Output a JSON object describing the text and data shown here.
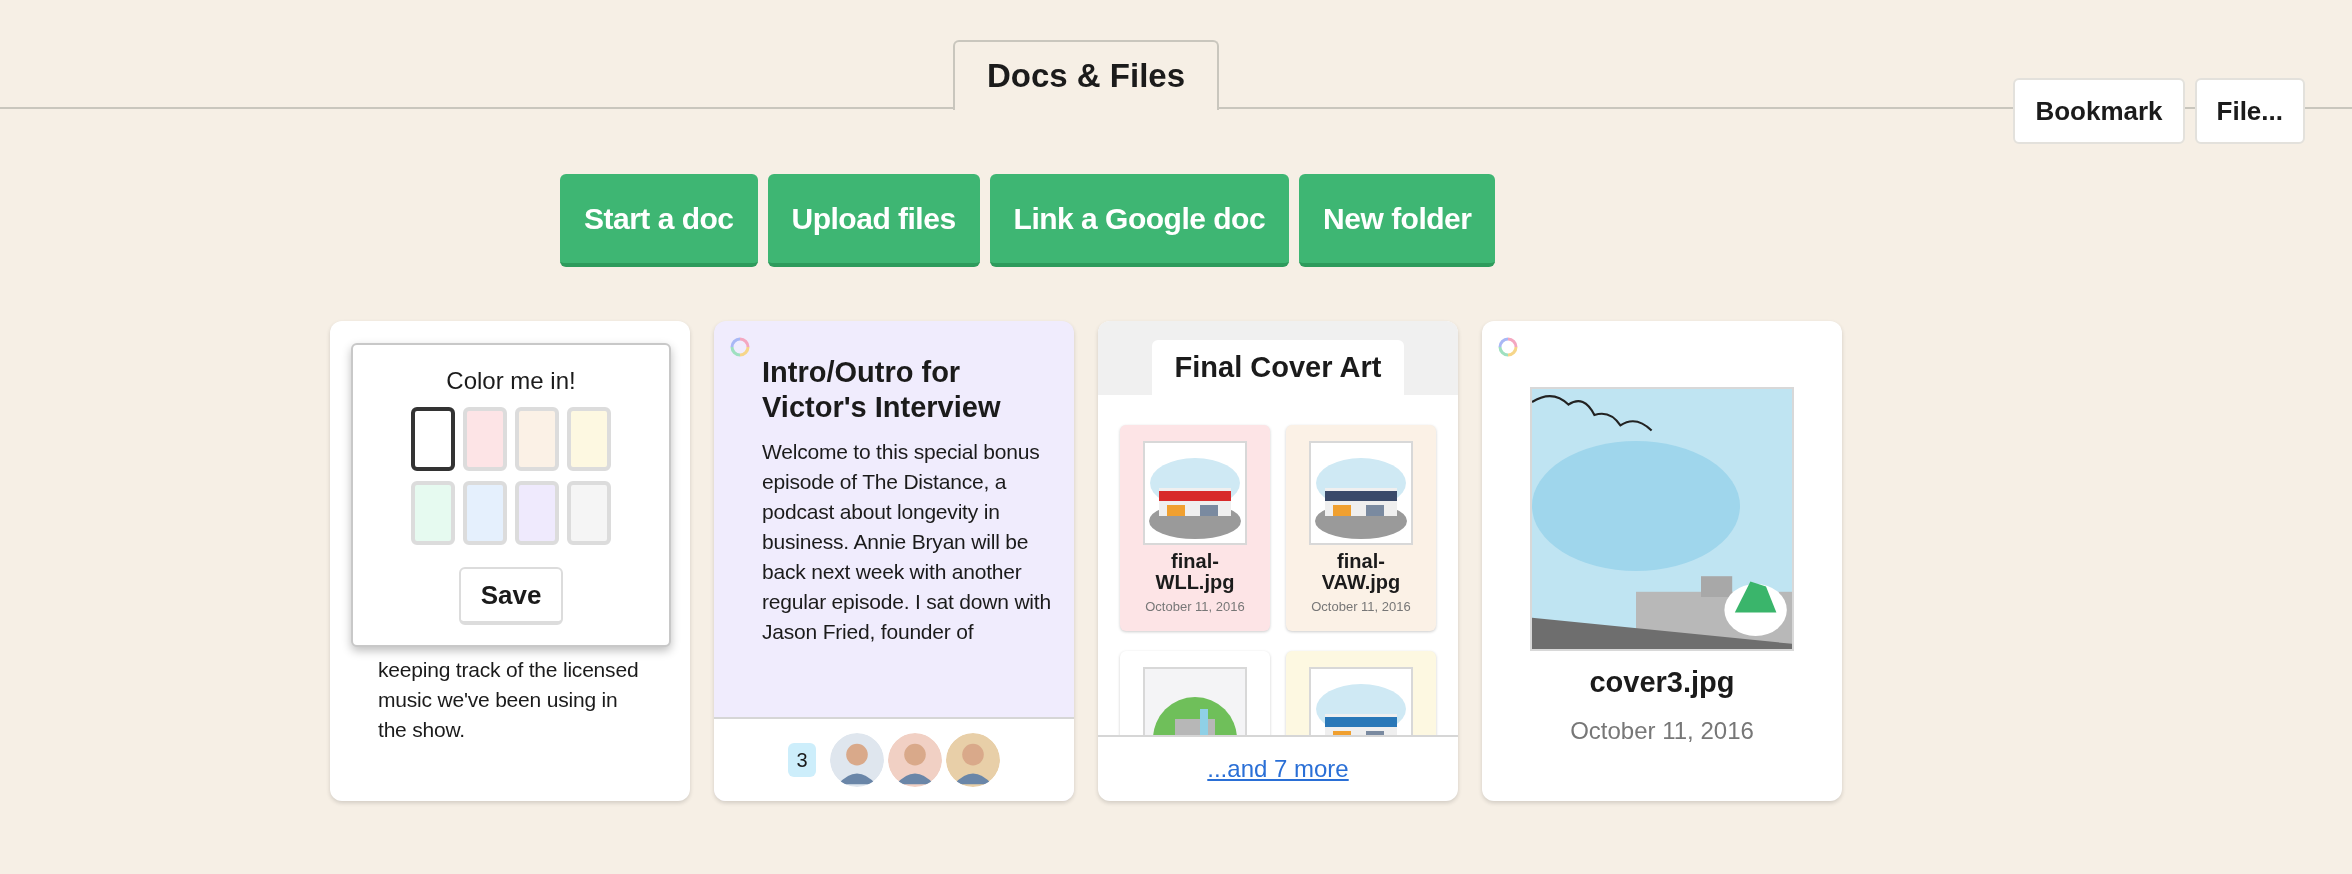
{
  "tab": {
    "label": "Docs & Files",
    "selected": true
  },
  "actions": [
    {
      "label": "Bookmark"
    },
    {
      "label": "File..."
    }
  ],
  "buttons": [
    "Start a doc",
    "Upload files",
    "Link a Google doc",
    "New folder"
  ],
  "cards": [
    {
      "kind": "doc",
      "color": "#ffffff",
      "body": "keeping track of the licensed music we've been using in the show.",
      "color_picker": {
        "title": "Color me in!",
        "save": "Save",
        "swatches": [
          {
            "color": "#ffffff",
            "selected": true
          },
          {
            "color": "#fde4e6",
            "selected": false
          },
          {
            "color": "#fbf1e6",
            "selected": false
          },
          {
            "color": "#fdf8e1",
            "selected": false
          },
          {
            "color": "#e6faf0",
            "selected": false
          },
          {
            "color": "#e5f0fd",
            "selected": false
          },
          {
            "color": "#efeafd",
            "selected": false
          },
          {
            "color": "#f5f5f5",
            "selected": false
          }
        ]
      }
    },
    {
      "kind": "doc",
      "color": "#f0ecfd",
      "title": "Intro/Outro for Victor's Interview",
      "body": "Welcome to this special bonus episode of The Distance, a podcast about longevity in business. Annie Bryan will be back next week with another regular episode. I sat down with Jason Fried, founder of",
      "comments": "3"
    },
    {
      "kind": "folder",
      "color": "#ffffff",
      "title": "Final Cover Art",
      "files": [
        {
          "name": "final-WLL.jpg",
          "date": "October 11, 2016",
          "color": "#fde4e6"
        },
        {
          "name": "final-VAW.jpg",
          "date": "October 11, 2016",
          "color": "#fbf1e6"
        },
        {
          "color": "#ffffff"
        },
        {
          "color": "#fdf8e1"
        }
      ],
      "more": "...and 7 more"
    },
    {
      "kind": "file",
      "color": "#ffffff",
      "name": "cover3.jpg",
      "date": "October 11, 2016"
    }
  ]
}
